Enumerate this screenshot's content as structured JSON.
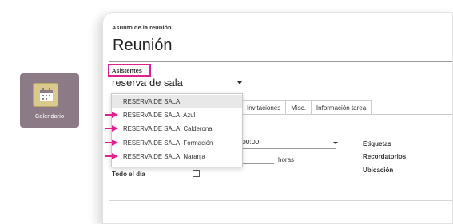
{
  "app_tile": {
    "label": "Calendario",
    "icon": "calendar-icon",
    "color": "#8c7b87"
  },
  "form": {
    "subject_label": "Asunto de la reunión",
    "subject_value": "Reunión",
    "attendees_label": "Asistentes",
    "attendees_value": "reserva de sala",
    "highlight_color": "#e0208f"
  },
  "tabs": [
    "Invitaciones",
    "Misc.",
    "Información tarea"
  ],
  "dropdown": {
    "options": [
      "RESERVA DE SALA",
      "RESERVA DE SALA, Azul",
      "RESERVA DE SALA, Calderona",
      "RESERVA DE SALA, Formación",
      "RESERVA DE SALA, Naranja"
    ],
    "highlighted_index": 0
  },
  "fields": {
    "time_value": "00:00",
    "hours_label": "horas",
    "all_day_label": "Todo el día",
    "all_day_checked": false,
    "right_labels": [
      "Etiquetas",
      "Recordatorios",
      "Ubicación"
    ]
  },
  "annotation_arrows": {
    "count": 4,
    "color": "#e0208f",
    "icon": "arrow-right-icon"
  }
}
